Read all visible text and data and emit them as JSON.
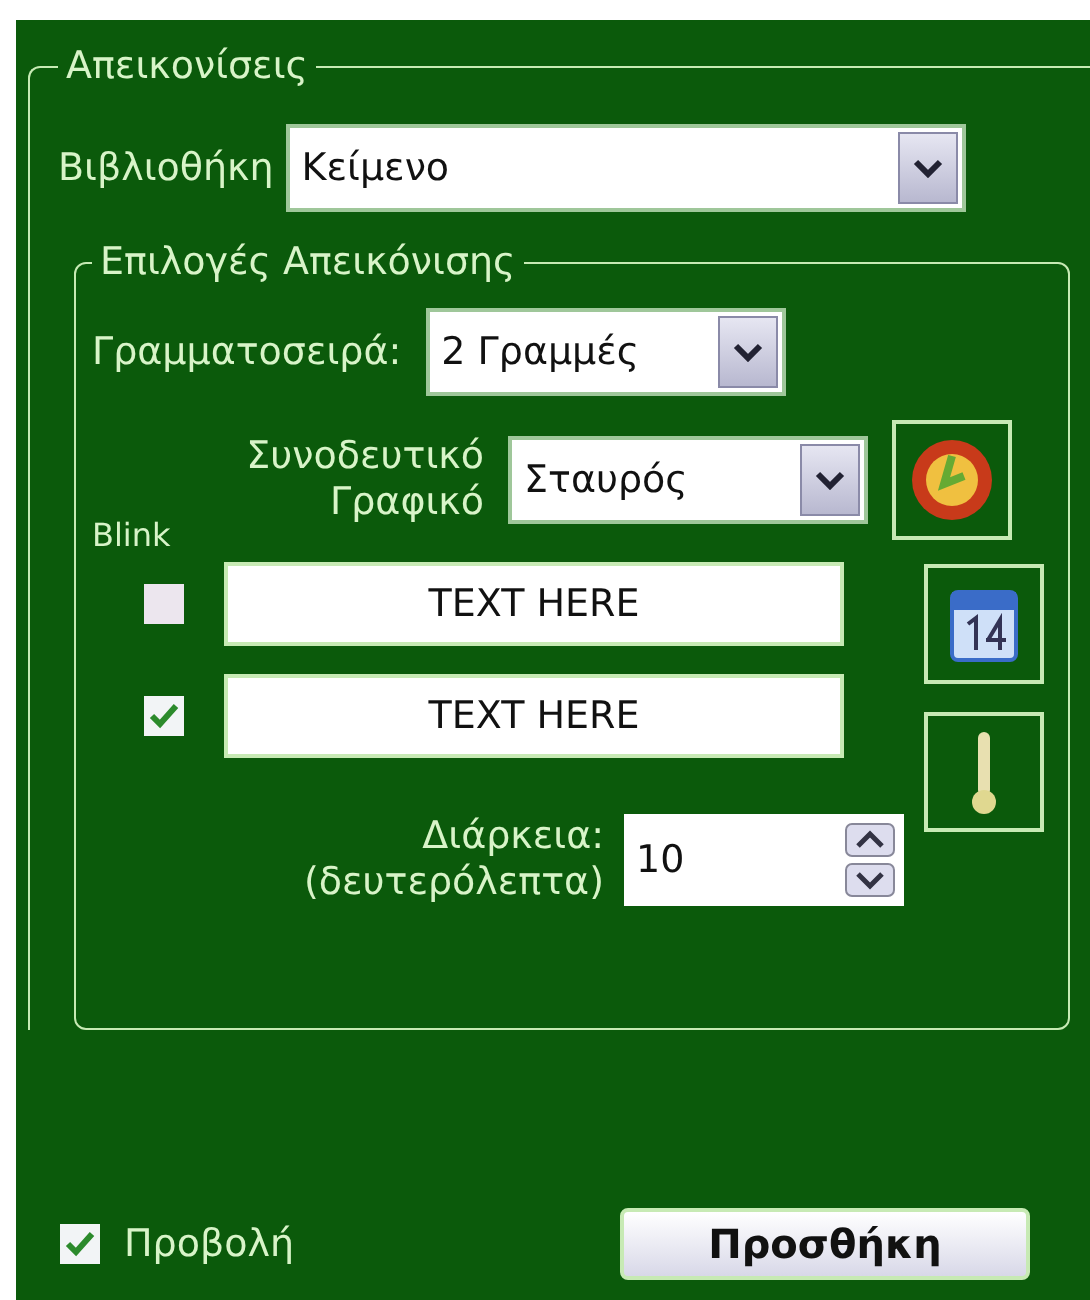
{
  "group_title": "Απεικονίσεις",
  "library": {
    "label": "Βιβλιοθήκη",
    "value": "Κείμενο"
  },
  "options": {
    "title": "Επιλογές Απεικόνισης",
    "font": {
      "label": "Γραμματοσειρά:",
      "value": "2 Γραμμές"
    },
    "graphic": {
      "label_lines": [
        "Συνοδευτικό",
        "Γραφικό"
      ],
      "value": "Σταυρός"
    },
    "blink_label": "Blink",
    "text_rows": [
      {
        "checked": false,
        "value": "TEXT HERE"
      },
      {
        "checked": true,
        "value": "TEXT HERE"
      }
    ],
    "duration": {
      "label_lines": [
        "Διάρκεια:",
        "(δευτερόλεπτα)"
      ],
      "value": "10"
    }
  },
  "show": {
    "label": "Προβολή",
    "checked": true
  },
  "add_button": "Προσθήκη"
}
